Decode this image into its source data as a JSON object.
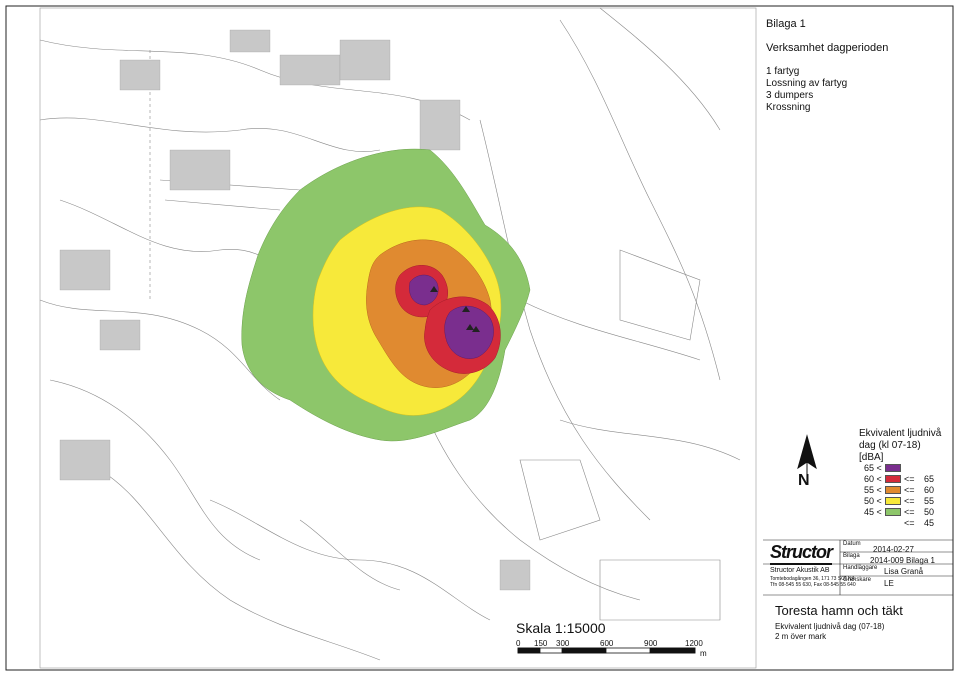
{
  "panel": {
    "header": "Bilaga 1",
    "period": "Verksamhet dagperioden",
    "activities": [
      "1 fartyg",
      "Lossning av fartyg",
      "3 dumpers",
      "Krossning"
    ]
  },
  "legend": {
    "title_lines": [
      "Ekvivalent ljudnivå",
      "dag (kl 07-18)",
      "[dBA]"
    ],
    "rows": [
      {
        "lo": "65 <",
        "op": "",
        "hi": "",
        "color": "#7a2e8e"
      },
      {
        "lo": "60 <",
        "op": "<=",
        "hi": "65",
        "color": "#d42a3a"
      },
      {
        "lo": "55 <",
        "op": "<=",
        "hi": "60",
        "color": "#e08a30"
      },
      {
        "lo": "50 <",
        "op": "<=",
        "hi": "55",
        "color": "#f7e93a"
      },
      {
        "lo": "45 <",
        "op": "<=",
        "hi": "50",
        "color": "#8dc66a"
      },
      {
        "lo": "",
        "op": "<=",
        "hi": "45",
        "color": "#ffffff"
      }
    ]
  },
  "north_label": "N",
  "titleblock": {
    "logo": "Structor",
    "company": "Structor Akustik AB",
    "address": "Tomtebodagången 36, 171 73 SOLNA",
    "phone": "Tfn 08-545 55 630, Fax 08-545 55 640",
    "datum_label": "Datum",
    "datum_value": "2014-02-27",
    "bilaga_label": "Bilaga",
    "bilaga_value": "2014-009 Bilaga 1",
    "handlaggare_label": "Handläggare",
    "handlaggare_value": "Lisa Granå",
    "granskare_label": "Granskare",
    "granskare_value": "LE"
  },
  "project": {
    "title": "Toresta hamn och täkt",
    "subtitle": "Ekvivalent ljudnivå dag (07-18)",
    "subtitle2": "2 m över mark"
  },
  "scale": {
    "label": "Skala 1:15000",
    "ticks": [
      "0",
      "150",
      "300",
      "600",
      "900",
      "1200"
    ],
    "unit": "m"
  },
  "colors": {
    "purple": "#7a2e8e",
    "red": "#d42a3a",
    "orange": "#e08a30",
    "yellow": "#f7e93a",
    "green": "#8dc66a"
  }
}
